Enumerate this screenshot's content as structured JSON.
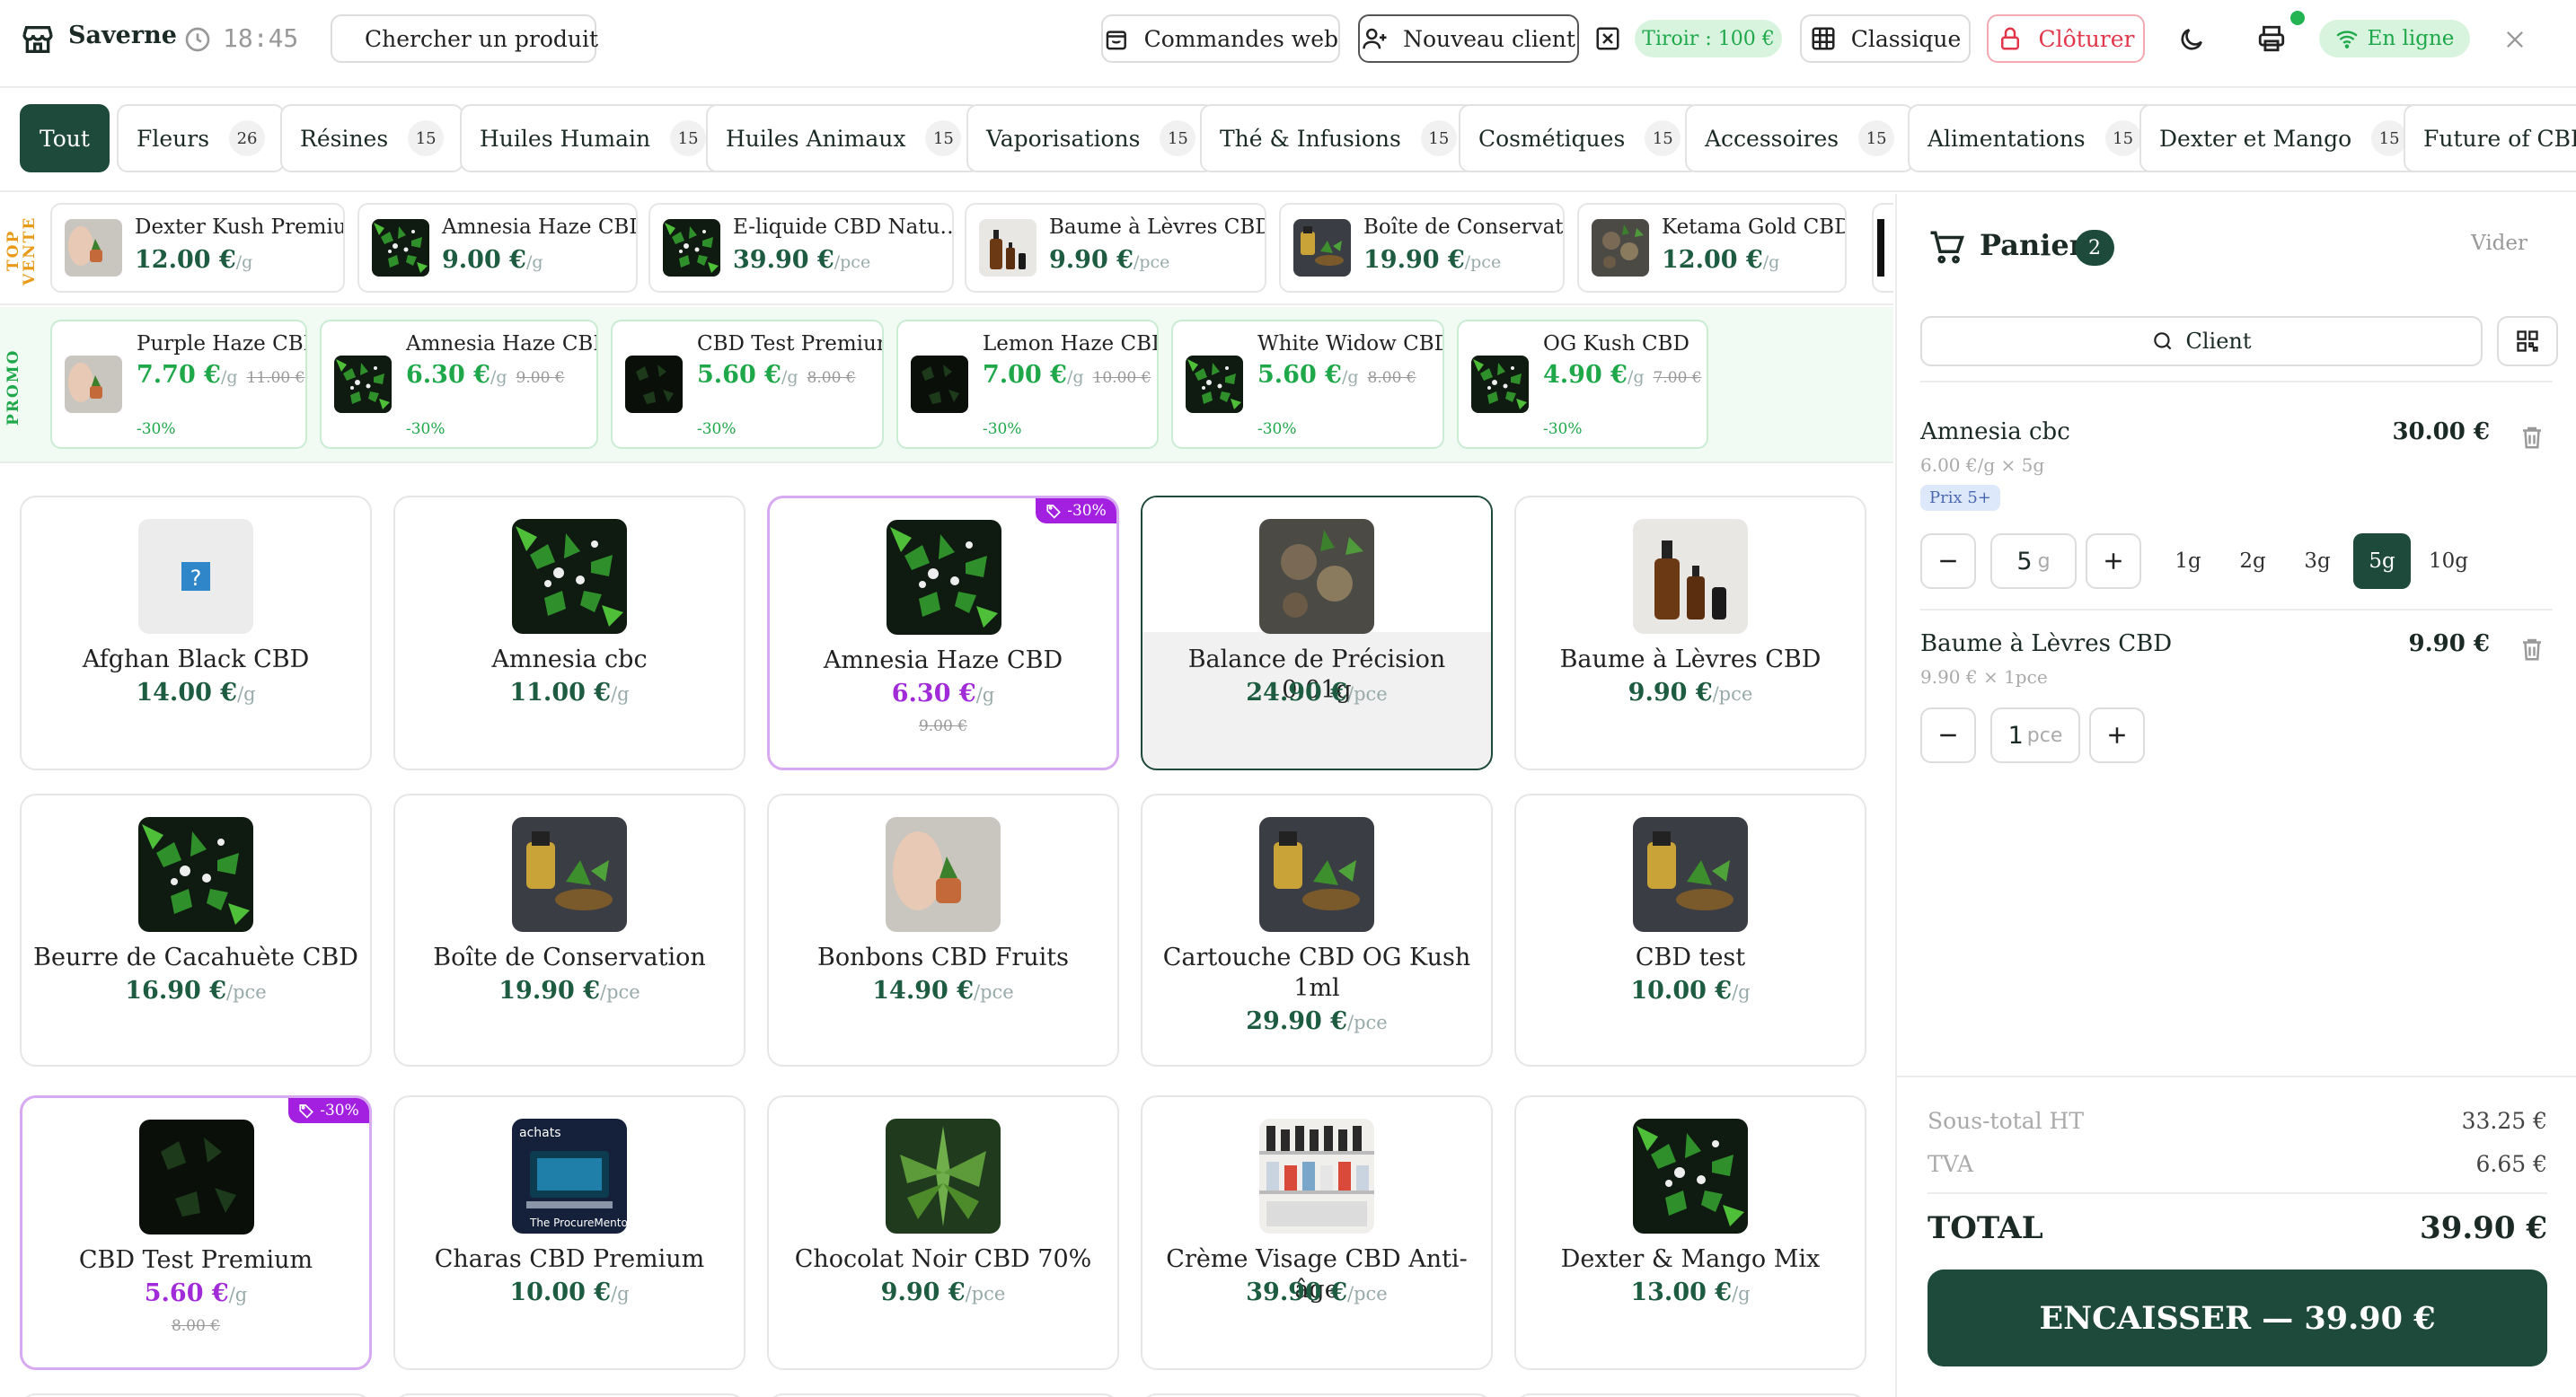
{
  "header": {
    "store": "Saverne",
    "time": "18:45",
    "search_placeholder": "Chercher un produit",
    "web_orders": "Commandes web",
    "new_client": "Nouveau client",
    "drawer": "Tiroir : 100 €",
    "mode": "Classique",
    "close_register": "Clôturer",
    "status": "En ligne"
  },
  "categories": [
    {
      "label": "Tout",
      "count": ""
    },
    {
      "label": "Fleurs",
      "count": "26"
    },
    {
      "label": "Résines",
      "count": "15"
    },
    {
      "label": "Huiles Humain",
      "count": "15"
    },
    {
      "label": "Huiles Animaux",
      "count": "15"
    },
    {
      "label": "Vaporisations",
      "count": "15"
    },
    {
      "label": "Thé & Infusions",
      "count": "15"
    },
    {
      "label": "Cosmétiques",
      "count": "15"
    },
    {
      "label": "Accessoires",
      "count": "15"
    },
    {
      "label": "Alimentations",
      "count": "15"
    },
    {
      "label": "Dexter et Mango",
      "count": "15"
    },
    {
      "label": "Future of CBD",
      "count": ""
    }
  ],
  "top_sales": {
    "label": "TOP VENTE",
    "items": [
      {
        "name": "Dexter Kush Premium",
        "price": "12.00 €",
        "unit": "/g"
      },
      {
        "name": "Amnesia Haze CBD",
        "price": "9.00 €",
        "unit": "/g"
      },
      {
        "name": "E-liquide CBD Natu…",
        "price": "39.90 €",
        "unit": "/pce"
      },
      {
        "name": "Baume à Lèvres CBD",
        "price": "9.90 €",
        "unit": "/pce"
      },
      {
        "name": "Boîte de Conservation",
        "price": "19.90 €",
        "unit": "/pce"
      },
      {
        "name": "Ketama Gold CBD",
        "price": "12.00 €",
        "unit": "/g"
      }
    ]
  },
  "promo": {
    "label": "PROMO",
    "items": [
      {
        "name": "Purple Haze CBD",
        "price": "7.70 €",
        "unit": "/g",
        "old": "11.00 €",
        "discount": "-30%"
      },
      {
        "name": "Amnesia Haze CBD",
        "price": "6.30 €",
        "unit": "/g",
        "old": "9.00 €",
        "discount": "-30%"
      },
      {
        "name": "CBD Test Premium",
        "price": "5.60 €",
        "unit": "/g",
        "old": "8.00 €",
        "discount": "-30%"
      },
      {
        "name": "Lemon Haze CBD",
        "price": "7.00 €",
        "unit": "/g",
        "old": "10.00 €",
        "discount": "-30%"
      },
      {
        "name": "White Widow CBD",
        "price": "5.60 €",
        "unit": "/g",
        "old": "8.00 €",
        "discount": "-30%"
      },
      {
        "name": "OG Kush CBD",
        "price": "4.90 €",
        "unit": "/g",
        "old": "7.00 €",
        "discount": "-30%"
      }
    ]
  },
  "products": [
    {
      "name": "Afghan Black CBD",
      "price": "14.00 €",
      "unit": "/g",
      "old": "",
      "badge": "",
      "img": "placeholder"
    },
    {
      "name": "Amnesia cbc",
      "price": "11.00 €",
      "unit": "/g",
      "old": "",
      "badge": "",
      "img": "plant"
    },
    {
      "name": "Amnesia Haze CBD",
      "price": "6.30 €",
      "unit": "/g",
      "old": "9.00 €",
      "badge": "-30%",
      "img": "plant"
    },
    {
      "name": "Balance de Précision 0.01g",
      "price": "24.90 €",
      "unit": "/pce",
      "old": "",
      "badge": "",
      "img": "bowls"
    },
    {
      "name": "Baume à Lèvres CBD",
      "price": "9.90 €",
      "unit": "/pce",
      "old": "",
      "badge": "",
      "img": "bottles"
    },
    {
      "name": "Beurre de Cacahuète CBD",
      "price": "16.90 €",
      "unit": "/pce",
      "old": "",
      "badge": "",
      "img": "plant"
    },
    {
      "name": "Boîte de Conservation",
      "price": "19.90 €",
      "unit": "/pce",
      "old": "",
      "badge": "",
      "img": "oil"
    },
    {
      "name": "Bonbons CBD Fruits",
      "price": "14.90 €",
      "unit": "/pce",
      "old": "",
      "badge": "",
      "img": "hand"
    },
    {
      "name": "Cartouche CBD OG Kush 1ml",
      "price": "29.90 €",
      "unit": "/pce",
      "old": "",
      "badge": "",
      "img": "oil"
    },
    {
      "name": "CBD test",
      "price": "10.00 €",
      "unit": "/g",
      "old": "",
      "badge": "",
      "img": "oil"
    },
    {
      "name": "CBD Test Premium",
      "price": "5.60 €",
      "unit": "/g",
      "old": "8.00 €",
      "badge": "-30%",
      "img": "dark"
    },
    {
      "name": "Charas CBD Premium",
      "price": "10.00 €",
      "unit": "/g",
      "old": "",
      "badge": "",
      "img": "screen"
    },
    {
      "name": "Chocolat Noir CBD 70%",
      "price": "9.90 €",
      "unit": "/pce",
      "old": "",
      "badge": "",
      "img": "leaf"
    },
    {
      "name": "Crème Visage CBD Anti-âge",
      "price": "39.90 €",
      "unit": "/pce",
      "old": "",
      "badge": "",
      "img": "shelf"
    },
    {
      "name": "Dexter & Mango Mix",
      "price": "13.00 €",
      "unit": "/g",
      "old": "",
      "badge": "",
      "img": "plant"
    }
  ],
  "cart": {
    "title": "Panier",
    "count": "2",
    "clear": "Vider",
    "client_label": "Client",
    "items": [
      {
        "name": "Amnesia cbc",
        "total": "30.00 €",
        "detail": "6.00 €/g × 5g",
        "tag": "Prix 5+",
        "qty": "5",
        "qty_unit": "g",
        "presets": [
          "1g",
          "2g",
          "3g",
          "5g",
          "10g"
        ],
        "active_preset": "5g"
      },
      {
        "name": "Baume à Lèvres CBD",
        "total": "9.90 €",
        "detail": "9.90 € × 1pce",
        "qty": "1",
        "qty_unit": "pce"
      }
    ],
    "subtotal_label": "Sous-total HT",
    "subtotal": "33.25 €",
    "tva_label": "TVA",
    "tva": "6.65 €",
    "total_label": "TOTAL",
    "total": "39.90 €",
    "checkout": "ENCAISSER — 39.90 €"
  },
  "colors": {
    "primary": "#1d4a3a",
    "accent_green": "#1fa84a",
    "promo_purple": "#a320e0",
    "danger": "#e2364a"
  }
}
